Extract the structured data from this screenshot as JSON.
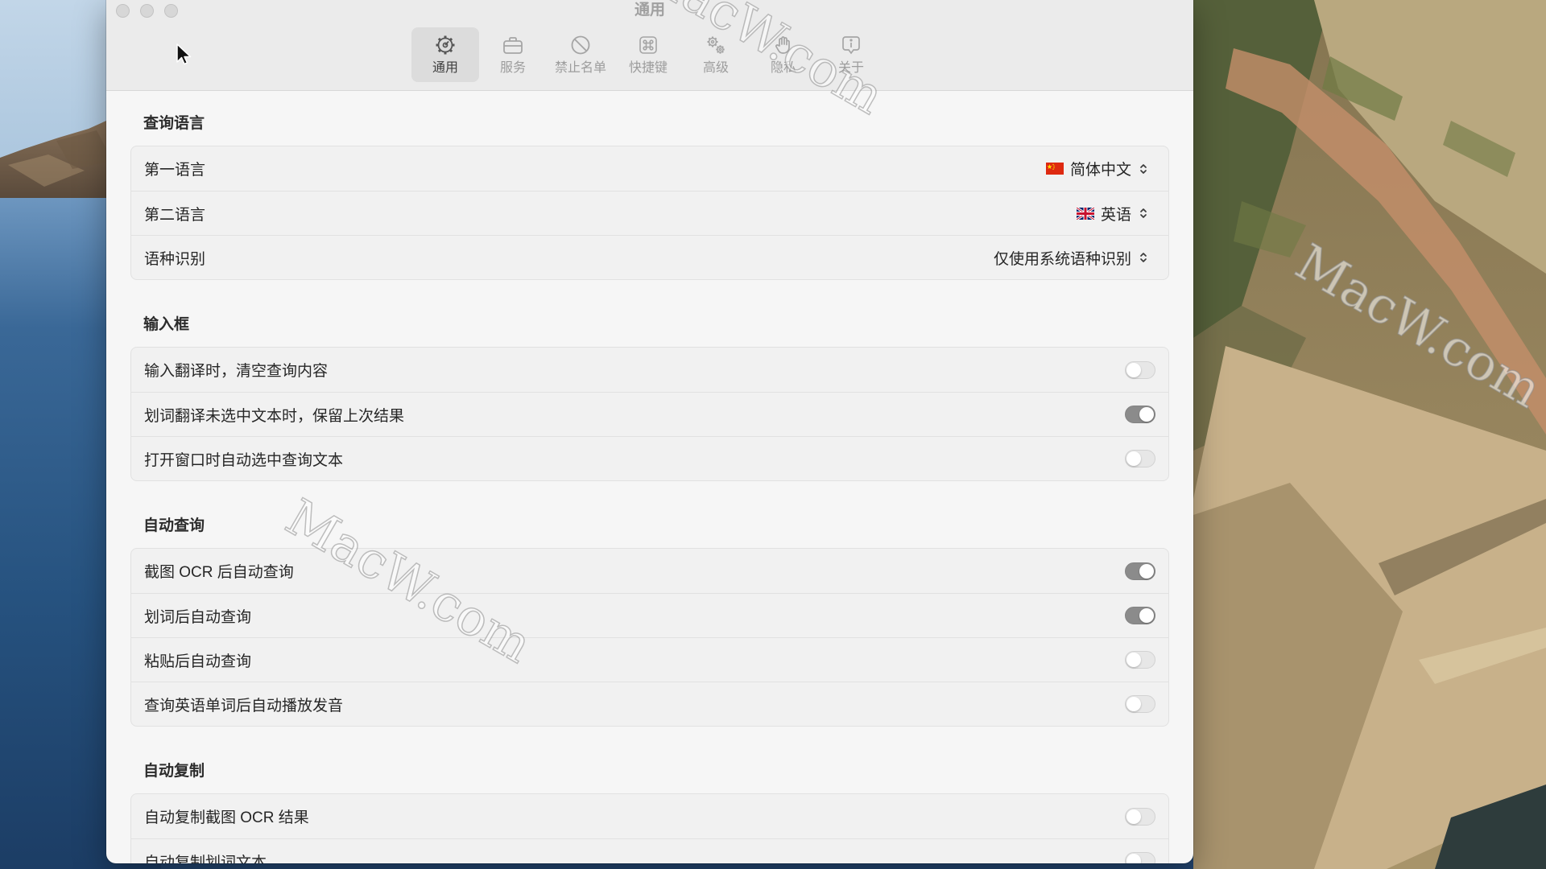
{
  "window": {
    "title": "通用"
  },
  "toolbar": {
    "tabs": [
      {
        "label": "通用",
        "icon": "gear-icon",
        "selected": true
      },
      {
        "label": "服务",
        "icon": "briefcase-icon",
        "selected": false
      },
      {
        "label": "禁止名单",
        "icon": "prohibited-icon",
        "selected": false
      },
      {
        "label": "快捷键",
        "icon": "command-key-icon",
        "selected": false
      },
      {
        "label": "高级",
        "icon": "gears-icon",
        "selected": false
      },
      {
        "label": "隐私",
        "icon": "hand-icon",
        "selected": false
      },
      {
        "label": "关于",
        "icon": "info-bubble-icon",
        "selected": false
      }
    ]
  },
  "sections": [
    {
      "heading": "查询语言",
      "rows": [
        {
          "label": "第一语言",
          "value": "简体中文",
          "flag": "cn-flag-icon"
        },
        {
          "label": "第二语言",
          "value": "英语",
          "flag": "uk-flag-icon"
        },
        {
          "label": "语种识别",
          "value": "仅使用系统语种识别"
        }
      ]
    },
    {
      "heading": "输入框",
      "rows": [
        {
          "label": "输入翻译时，清空查询内容",
          "enabled": false
        },
        {
          "label": "划词翻译未选中文本时，保留上次结果",
          "enabled": true
        },
        {
          "label": "打开窗口时自动选中查询文本",
          "enabled": false
        }
      ]
    },
    {
      "heading": "自动查询",
      "rows": [
        {
          "label": "截图 OCR 后自动查询",
          "enabled": true
        },
        {
          "label": "划词后自动查询",
          "enabled": true
        },
        {
          "label": "粘贴后自动查询",
          "enabled": false
        },
        {
          "label": "查询英语单词后自动播放发音",
          "enabled": false
        }
      ]
    },
    {
      "heading": "自动复制",
      "rows": [
        {
          "label": "自动复制截图 OCR 结果",
          "enabled": false
        },
        {
          "label": "自动复制划词文本",
          "enabled": false
        }
      ]
    }
  ],
  "watermark": {
    "text": "MacW.com"
  },
  "colors": {
    "toolbar_bg": "#ebebeb",
    "content_bg": "#f6f6f6",
    "group_bg": "#f1f1f1",
    "toggle_on": "#8b8b8b",
    "toggle_off": "#e7e7e7",
    "selected_tab_bg": "#dcdcdc"
  }
}
